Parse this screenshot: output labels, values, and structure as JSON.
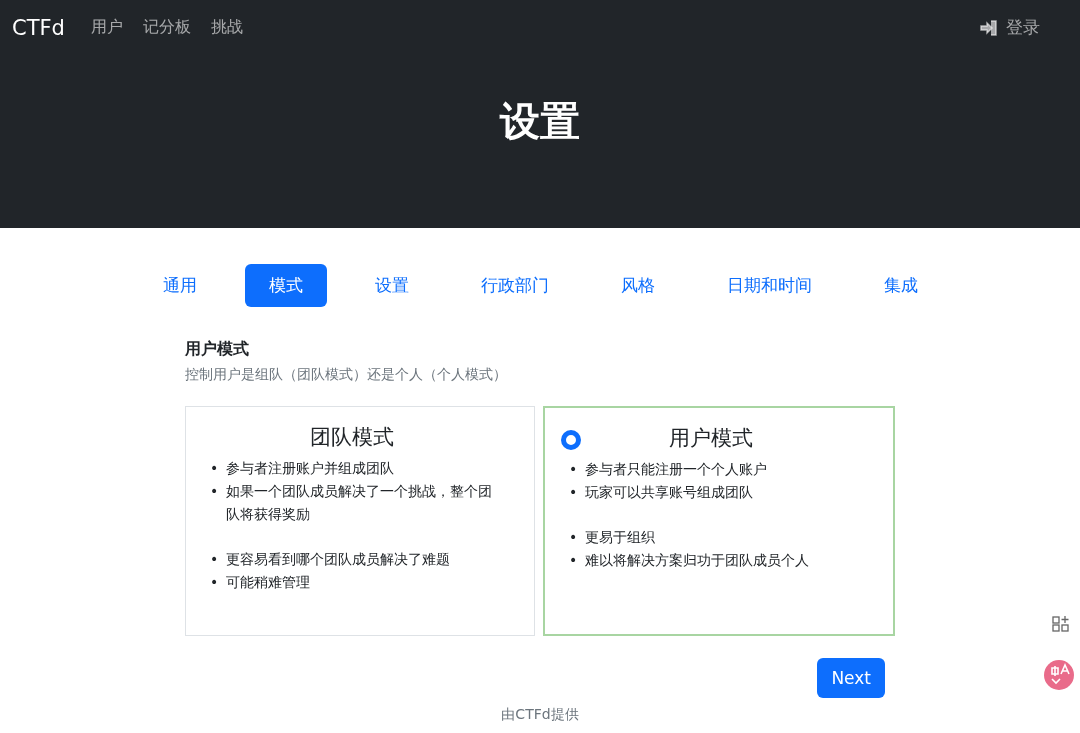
{
  "navbar": {
    "brand": "CTFd",
    "links": [
      "用户",
      "记分板",
      "挑战"
    ],
    "login": "登录"
  },
  "hero": {
    "title": "设置"
  },
  "tabs": [
    {
      "label": "通用",
      "selected": false
    },
    {
      "label": "模式",
      "selected": true
    },
    {
      "label": "设置",
      "selected": false
    },
    {
      "label": "行政部门",
      "selected": false
    },
    {
      "label": "风格",
      "selected": false
    },
    {
      "label": "日期和时间",
      "selected": false
    },
    {
      "label": "集成",
      "selected": false
    }
  ],
  "section": {
    "heading": "用户模式",
    "description": "控制用户是组队（团队模式）还是个人（个人模式）"
  },
  "modes": [
    {
      "title": "团队模式",
      "selected": false,
      "groups": [
        [
          "参与者注册账户并组成团队",
          "如果一个团队成员解决了一个挑战，整个团队将获得奖励"
        ],
        [
          "更容易看到哪个团队成员解决了难题",
          "可能稍难管理"
        ]
      ]
    },
    {
      "title": "用户模式",
      "selected": true,
      "groups": [
        [
          "参与者只能注册一个个人账户",
          "玩家可以共享账号组成团队"
        ],
        [
          "更易于组织",
          "难以将解决方案归功于团队成员个人"
        ]
      ]
    }
  ],
  "bullet": "•",
  "next_button": "Next",
  "footer": "由CTFd提供"
}
